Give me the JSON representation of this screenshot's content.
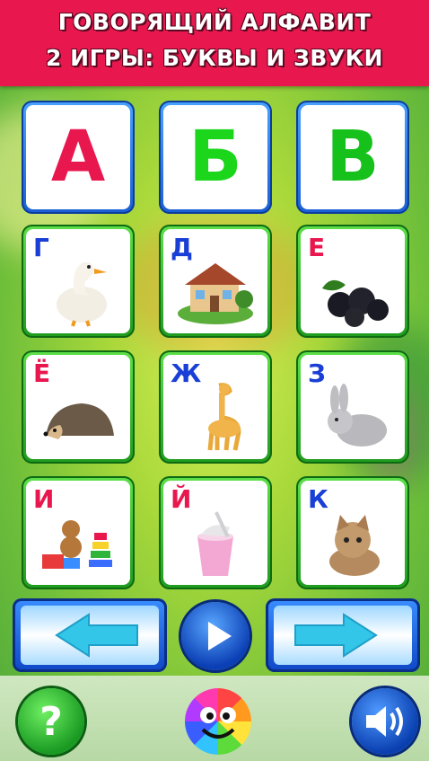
{
  "banner": {
    "line1": "ГОВОРЯЩИЙ АЛФАВИТ",
    "line2": "2 ИГРЫ: БУКВЫ И ЗВУКИ"
  },
  "top_letters": [
    {
      "letter": "А",
      "color": "#e8184f"
    },
    {
      "letter": "Б",
      "color": "#1bd61b"
    },
    {
      "letter": "В",
      "color": "#17c11b"
    }
  ],
  "cards": [
    {
      "letter": "Г",
      "color": "#1a3fd6",
      "icon": "goose-icon"
    },
    {
      "letter": "Д",
      "color": "#1a3fd6",
      "icon": "house-icon"
    },
    {
      "letter": "Е",
      "color": "#e8184f",
      "icon": "blackberry-icon"
    },
    {
      "letter": "Ё",
      "color": "#e8184f",
      "icon": "hedgehog-icon"
    },
    {
      "letter": "Ж",
      "color": "#1a3fd6",
      "icon": "giraffe-icon"
    },
    {
      "letter": "З",
      "color": "#1a3fd6",
      "icon": "rabbit-icon"
    },
    {
      "letter": "И",
      "color": "#e8184f",
      "icon": "toys-icon"
    },
    {
      "letter": "Й",
      "color": "#e8184f",
      "icon": "yogurt-icon"
    },
    {
      "letter": "К",
      "color": "#1a3fd6",
      "icon": "kitten-icon"
    }
  ],
  "controls": {
    "prev_icon": "arrow-left-icon",
    "play_icon": "play-icon",
    "next_icon": "arrow-right-icon",
    "help_label": "?",
    "smile_icon": "smiley-icon",
    "sound_icon": "speaker-icon"
  },
  "colors": {
    "banner": "#e8184f",
    "blue_frame": "#1a5fd4",
    "green_frame": "#1f9b1f"
  }
}
